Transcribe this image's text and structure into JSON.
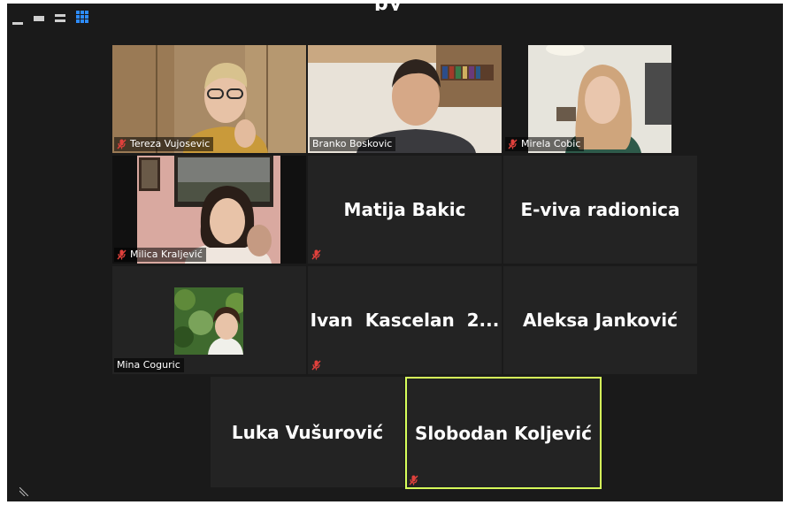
{
  "window": {
    "title_fragment": "py"
  },
  "view_controls": [
    "minimize-view",
    "filmstrip-view",
    "speaker-view",
    "gallery-view"
  ],
  "colors": {
    "background": "#1a1a1a",
    "tile": "#232323",
    "active_speaker_border": "#d6ff5a",
    "gallery_icon": "#2d8cff",
    "muted_icon": "#e0413c"
  },
  "participants": [
    {
      "name": "Tereza Vujosevic",
      "muted": true,
      "video": true
    },
    {
      "name": "Branko Boskovic",
      "muted": false,
      "video": true
    },
    {
      "name": "Mirela Cobic",
      "muted": true,
      "video": true
    },
    {
      "name": "Milica Kraljević",
      "muted": true,
      "video": true
    },
    {
      "name": "Matija Bakic",
      "muted": true,
      "video": false
    },
    {
      "name": "E-viva radionica",
      "muted": false,
      "video": false
    },
    {
      "name": "Mina Coguric",
      "muted": false,
      "video": false,
      "has_profile_picture": true
    },
    {
      "name": "Ivan  Kascelan  2...",
      "muted": true,
      "video": false
    },
    {
      "name": "Aleksa Janković",
      "muted": false,
      "video": false
    },
    {
      "name": "Luka Vušurović",
      "muted": false,
      "video": false
    },
    {
      "name": "Slobodan Koljević",
      "muted": true,
      "video": false,
      "active_speaker": true
    }
  ]
}
